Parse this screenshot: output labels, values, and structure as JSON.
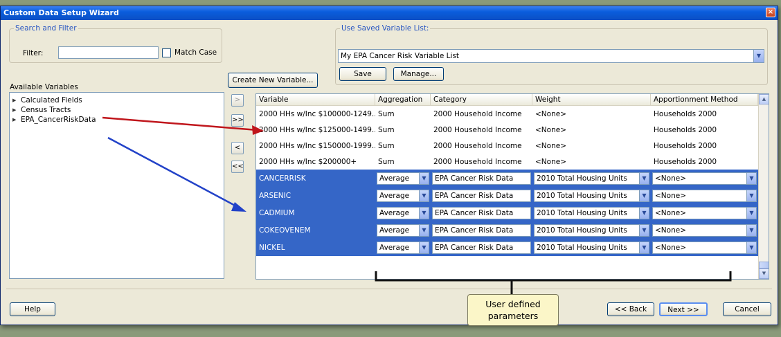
{
  "window": {
    "title": "Custom Data Setup Wizard",
    "close": "×"
  },
  "search": {
    "legend": "Search and Filter",
    "filter_label": "Filter:",
    "filter_value": "",
    "match_case_label": "Match Case"
  },
  "saved_list": {
    "legend": "Use Saved Variable List:",
    "selected": "My EPA Cancer Risk Variable List",
    "save_label": "Save",
    "manage_label": "Manage..."
  },
  "create_variable_label": "Create New Variable...",
  "available": {
    "label": "Available Variables",
    "items": [
      "Calculated Fields",
      "Census Tracts",
      "EPA_CancerRiskData"
    ]
  },
  "transfer_buttons": [
    ">",
    ">>",
    "<",
    "<<"
  ],
  "grid": {
    "columns": [
      "Variable",
      "Aggregation",
      "Category",
      "Weight",
      "Apportionment Method"
    ],
    "plain_rows": [
      {
        "variable": "2000 HHs w/Inc $100000-1249...",
        "aggregation": "Sum",
        "category": "2000 Household Income",
        "weight": "<None>",
        "apportionment": "Households 2000"
      },
      {
        "variable": "2000 HHs w/Inc $125000-1499...",
        "aggregation": "Sum",
        "category": "2000 Household Income",
        "weight": "<None>",
        "apportionment": "Households 2000"
      },
      {
        "variable": "2000 HHs w/Inc $150000-1999...",
        "aggregation": "Sum",
        "category": "2000 Household Income",
        "weight": "<None>",
        "apportionment": "Households 2000"
      },
      {
        "variable": "2000 HHs w/Inc $200000+",
        "aggregation": "Sum",
        "category": "2000 Household Income",
        "weight": "<None>",
        "apportionment": "Households 2000"
      }
    ],
    "selected_rows": [
      {
        "variable": "CANCERRISK",
        "aggregation": "Average",
        "category": "EPA Cancer Risk Data",
        "weight": "2010 Total Housing Units",
        "apportionment": "<None>"
      },
      {
        "variable": "ARSENIC",
        "aggregation": "Average",
        "category": "EPA Cancer Risk Data",
        "weight": "2010 Total Housing Units",
        "apportionment": "<None>"
      },
      {
        "variable": "CADMIUM",
        "aggregation": "Average",
        "category": "EPA Cancer Risk Data",
        "weight": "2010 Total Housing Units",
        "apportionment": "<None>"
      },
      {
        "variable": "COKEOVENEM",
        "aggregation": "Average",
        "category": "EPA Cancer Risk Data",
        "weight": "2010 Total Housing Units",
        "apportionment": "<None>"
      },
      {
        "variable": "NICKEL",
        "aggregation": "Average",
        "category": "EPA Cancer Risk Data",
        "weight": "2010 Total Housing Units",
        "apportionment": "<None>"
      }
    ]
  },
  "footer": {
    "help_label": "Help",
    "back_label": "<< Back",
    "next_label": "Next >>",
    "cancel_label": "Cancel"
  },
  "callout": {
    "line1": "User defined",
    "line2": "parameters"
  },
  "colors": {
    "selection": "#3566c7",
    "title_bar": "#0b4fc4",
    "arrow_red": "#c0161c",
    "arrow_blue": "#2242c8"
  }
}
